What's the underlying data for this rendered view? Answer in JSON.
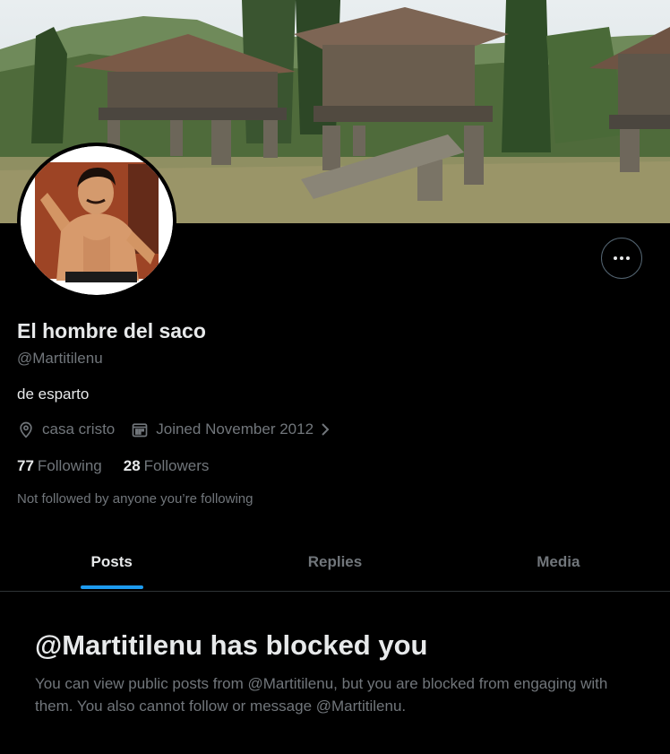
{
  "profile": {
    "name": "El hombre del saco",
    "handle": "@Martitilenu",
    "bio": "de esparto",
    "location": "casa cristo",
    "joined": "Joined November 2012",
    "following_count": "77",
    "following_label": "Following",
    "followers_count": "28",
    "followers_label": "Followers",
    "not_followed_text": "Not followed by anyone you’re following"
  },
  "tabs": [
    {
      "label": "Posts",
      "active": true
    },
    {
      "label": "Replies",
      "active": false
    },
    {
      "label": "Media",
      "active": false
    }
  ],
  "blocked": {
    "title": "@Martitilenu has blocked you",
    "message": "You can view public posts from @Martitilenu, but you are blocked from engaging with them. You also cannot follow or message @Martitilenu."
  },
  "colors": {
    "background": "#000000",
    "primary_text": "#e7e9ea",
    "secondary_text": "#71767b",
    "accent": "#1d9bf0",
    "border": "#2f3336"
  },
  "icons": [
    "more-options-icon",
    "location-pin-icon",
    "calendar-icon",
    "chevron-right-icon"
  ]
}
